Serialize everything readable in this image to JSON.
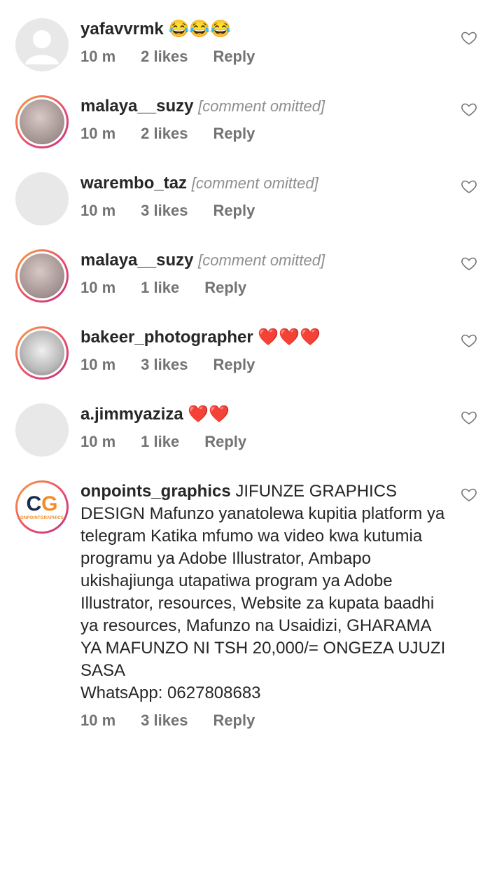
{
  "comments": [
    {
      "username": "yafavvrmk",
      "text": "😂😂😂",
      "time": "10 m",
      "likes": "2 likes",
      "reply": "Reply",
      "hidden": false,
      "avatar": "default-avatar"
    },
    {
      "username": "malaya__suzy",
      "text": "",
      "note": "[comment omitted]",
      "time": "10 m",
      "likes": "2 likes",
      "reply": "Reply",
      "hidden": true,
      "avatar": "photo-avatar"
    },
    {
      "username": "warembo_taz",
      "text": "",
      "note": "[comment omitted]",
      "time": "10 m",
      "likes": "3 likes",
      "reply": "Reply",
      "hidden": true,
      "avatar": "photo-avatar"
    },
    {
      "username": "malaya__suzy",
      "text": "",
      "note": "[comment omitted]",
      "time": "10 m",
      "likes": "1 like",
      "reply": "Reply",
      "hidden": true,
      "avatar": "photo-avatar"
    },
    {
      "username": "bakeer_photographer",
      "text": "❤️❤️❤️",
      "time": "10 m",
      "likes": "3 likes",
      "reply": "Reply",
      "hidden": false,
      "avatar": "photo-avatar"
    },
    {
      "username": "a.jimmyaziza",
      "text": "❤️❤️",
      "time": "10 m",
      "likes": "1 like",
      "reply": "Reply",
      "hidden": false,
      "avatar": "photo-avatar"
    },
    {
      "username": "onpoints_graphics",
      "text": "JIFUNZE GRAPHICS DESIGN Mafunzo yanatolewa kupitia platform ya telegram Katika mfumo wa video kwa kutumia programu ya Adobe Illustrator, Ambapo ukishajiunga utapatiwa program ya Adobe Illustrator, resources, Website za kupata baadhi ya resources, Mafunzo na Usaidizi, GHARAMA YA MAFUNZO NI TSH 20,000/= ONGEZA UJUZI SASA",
      "whatsapp": "WhatsApp: 0627808683",
      "time": "10 m",
      "likes": "3 likes",
      "reply": "Reply",
      "hidden": false,
      "avatar": "logo-avatar",
      "logo": {
        "c": "C",
        "g": "G",
        "sub": "ONPOINTGRAPHICS"
      }
    }
  ],
  "colors": {
    "text": "#262626",
    "meta": "#737373",
    "story_ring_start": "#f9a03f",
    "story_ring_end": "#c13584"
  },
  "icons": {
    "like": "heart-outline-icon"
  }
}
